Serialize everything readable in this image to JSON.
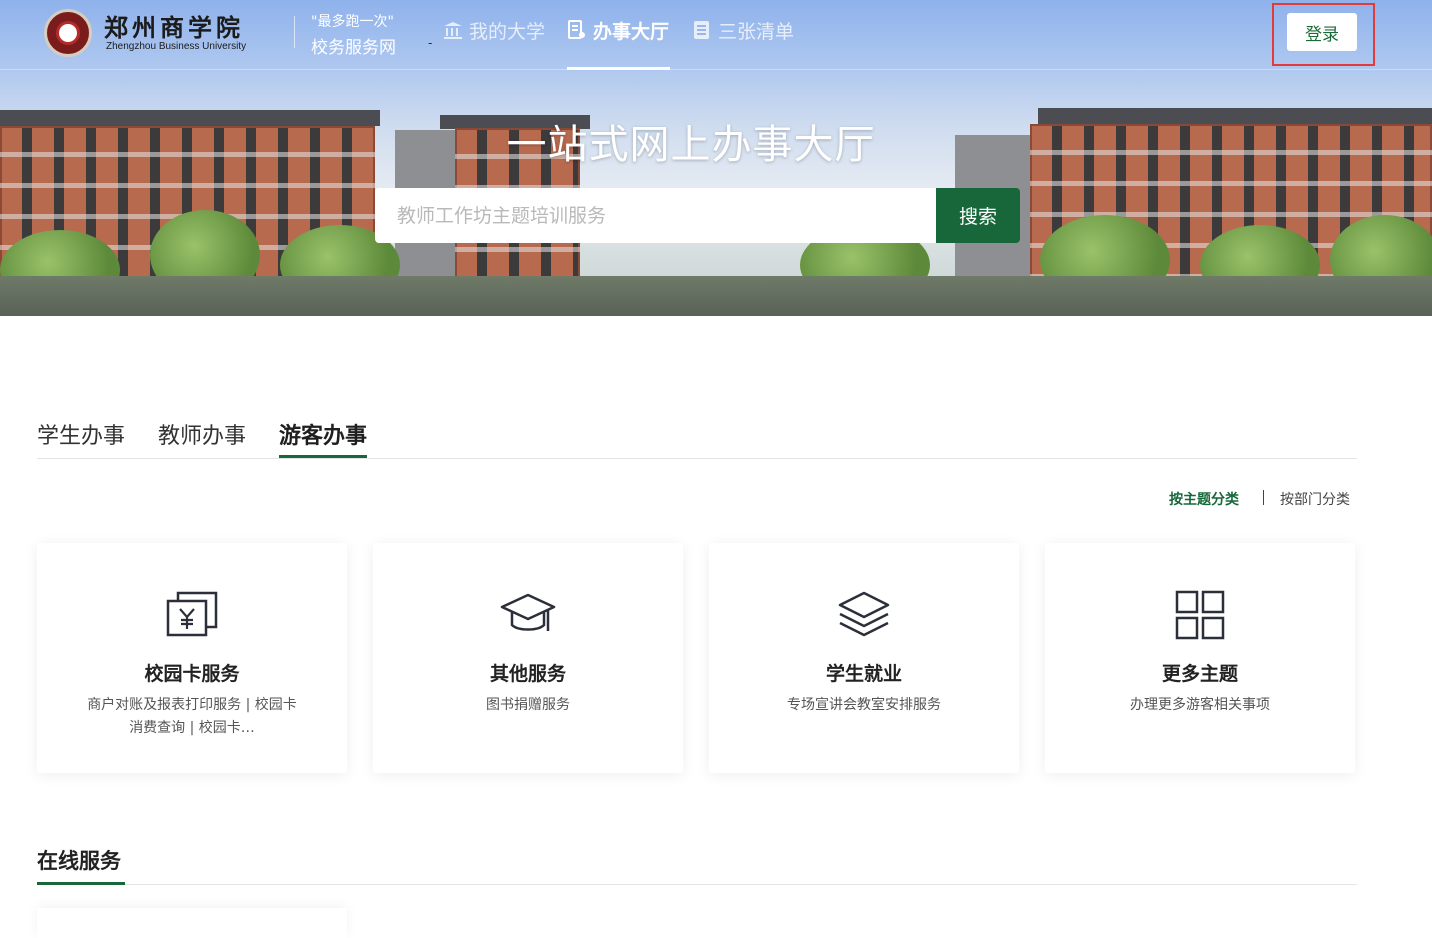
{
  "header": {
    "logo_cn": "郑州商学院",
    "logo_en": "Zhengzhou Business University",
    "slogan_line1": "\"最多跑一次\"",
    "slogan_line2": "校务服务网",
    "nav": [
      {
        "label": "我的大学",
        "icon": "university-icon",
        "active": false
      },
      {
        "label": "办事大厅",
        "icon": "service-hall-icon",
        "active": true
      },
      {
        "label": "三张清单",
        "icon": "list-icon",
        "active": false
      }
    ],
    "login_label": "登录"
  },
  "hero": {
    "title": "一站式网上办事大厅",
    "search_placeholder": "教师工作坊主题培训服务",
    "search_button": "搜索"
  },
  "tabs": [
    {
      "label": "学生办事",
      "active": false
    },
    {
      "label": "教师办事",
      "active": false
    },
    {
      "label": "游客办事",
      "active": true
    }
  ],
  "classify": {
    "by_theme": "按主题分类",
    "by_department": "按部门分类"
  },
  "cards": [
    {
      "title": "校园卡服务",
      "desc": "商户对账及报表打印服务 | 校园卡消费查询 | 校园卡…",
      "icon": "campus-card-icon"
    },
    {
      "title": "其他服务",
      "desc": "图书捐赠服务",
      "icon": "graduation-cap-icon"
    },
    {
      "title": "学生就业",
      "desc": "专场宣讲会教室安排服务",
      "icon": "layers-icon"
    },
    {
      "title": "更多主题",
      "desc": "办理更多游客相关事项",
      "icon": "grid-icon"
    }
  ],
  "online": {
    "title": "在线服务"
  },
  "colors": {
    "brand_green": "#17673a",
    "login_highlight": "#e13b3b"
  }
}
